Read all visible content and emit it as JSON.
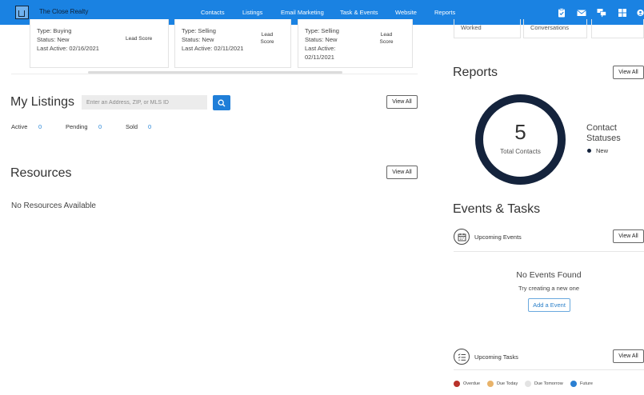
{
  "brand": {
    "name": "The Close Realty"
  },
  "nav": {
    "links": [
      "Contacts",
      "Listings",
      "Email Marketing",
      "Task & Events",
      "Website",
      "Reports"
    ],
    "icons": [
      "clipboard-check-icon",
      "mail-icon",
      "chat-icon",
      "grid-icon",
      "user-circle-icon"
    ]
  },
  "contact_cards": [
    {
      "type": "Type: Buying",
      "status": "Status: New",
      "last_active": "Last Active: 02/16/2021",
      "lead_score": "Lead Score"
    },
    {
      "type": "Type: Selling",
      "status": "Status: New",
      "last_active": "Last Active: 02/11/2021",
      "lead_score_line1": "Lead",
      "lead_score_line2": "Score"
    },
    {
      "type": "Type: Selling",
      "status": "Status: New",
      "last_active_line1": "Last Active:",
      "last_active_line2": "02/11/2021",
      "lead_score_line1": "Lead",
      "lead_score_line2": "Score"
    }
  ],
  "right_top_cards": {
    "left": "Worked",
    "right": "Conversations"
  },
  "listings": {
    "title": "My Listings",
    "search_placeholder": "Enter an Address, ZIP, or MLS ID",
    "view_all": "View All",
    "stats": [
      {
        "label": "Active",
        "value": "0"
      },
      {
        "label": "Pending",
        "value": "0"
      },
      {
        "label": "Sold",
        "value": "0"
      }
    ]
  },
  "resources": {
    "title": "Resources",
    "view_all": "View All",
    "empty": "No Resources Available"
  },
  "reports": {
    "title": "Reports",
    "view_all": "View All",
    "total": "5",
    "total_label": "Total Contacts",
    "legend_title": "Contact Statuses",
    "legend_items": [
      {
        "label": "New",
        "color": "#14233c"
      }
    ]
  },
  "events_tasks": {
    "title": "Events & Tasks",
    "upcoming_events": "Upcoming Events",
    "events_view_all": "View All",
    "no_events": "No Events Found",
    "try_create": "Try creating a new one",
    "add_event": "Add a Event",
    "upcoming_tasks": "Upcoming Tasks",
    "tasks_view_all": "View All",
    "task_legend": [
      {
        "label": "Overdue",
        "color": "#b8322a"
      },
      {
        "label": "Due Today",
        "color": "#e8b36a"
      },
      {
        "label": "Due Tomorrow",
        "color": "#e3e3e3"
      },
      {
        "label": "Future",
        "color": "#2a7fd2"
      }
    ]
  },
  "colors": {
    "nav": "#1a82e2",
    "accent": "#1f7ed8",
    "donut": "#14233c"
  }
}
